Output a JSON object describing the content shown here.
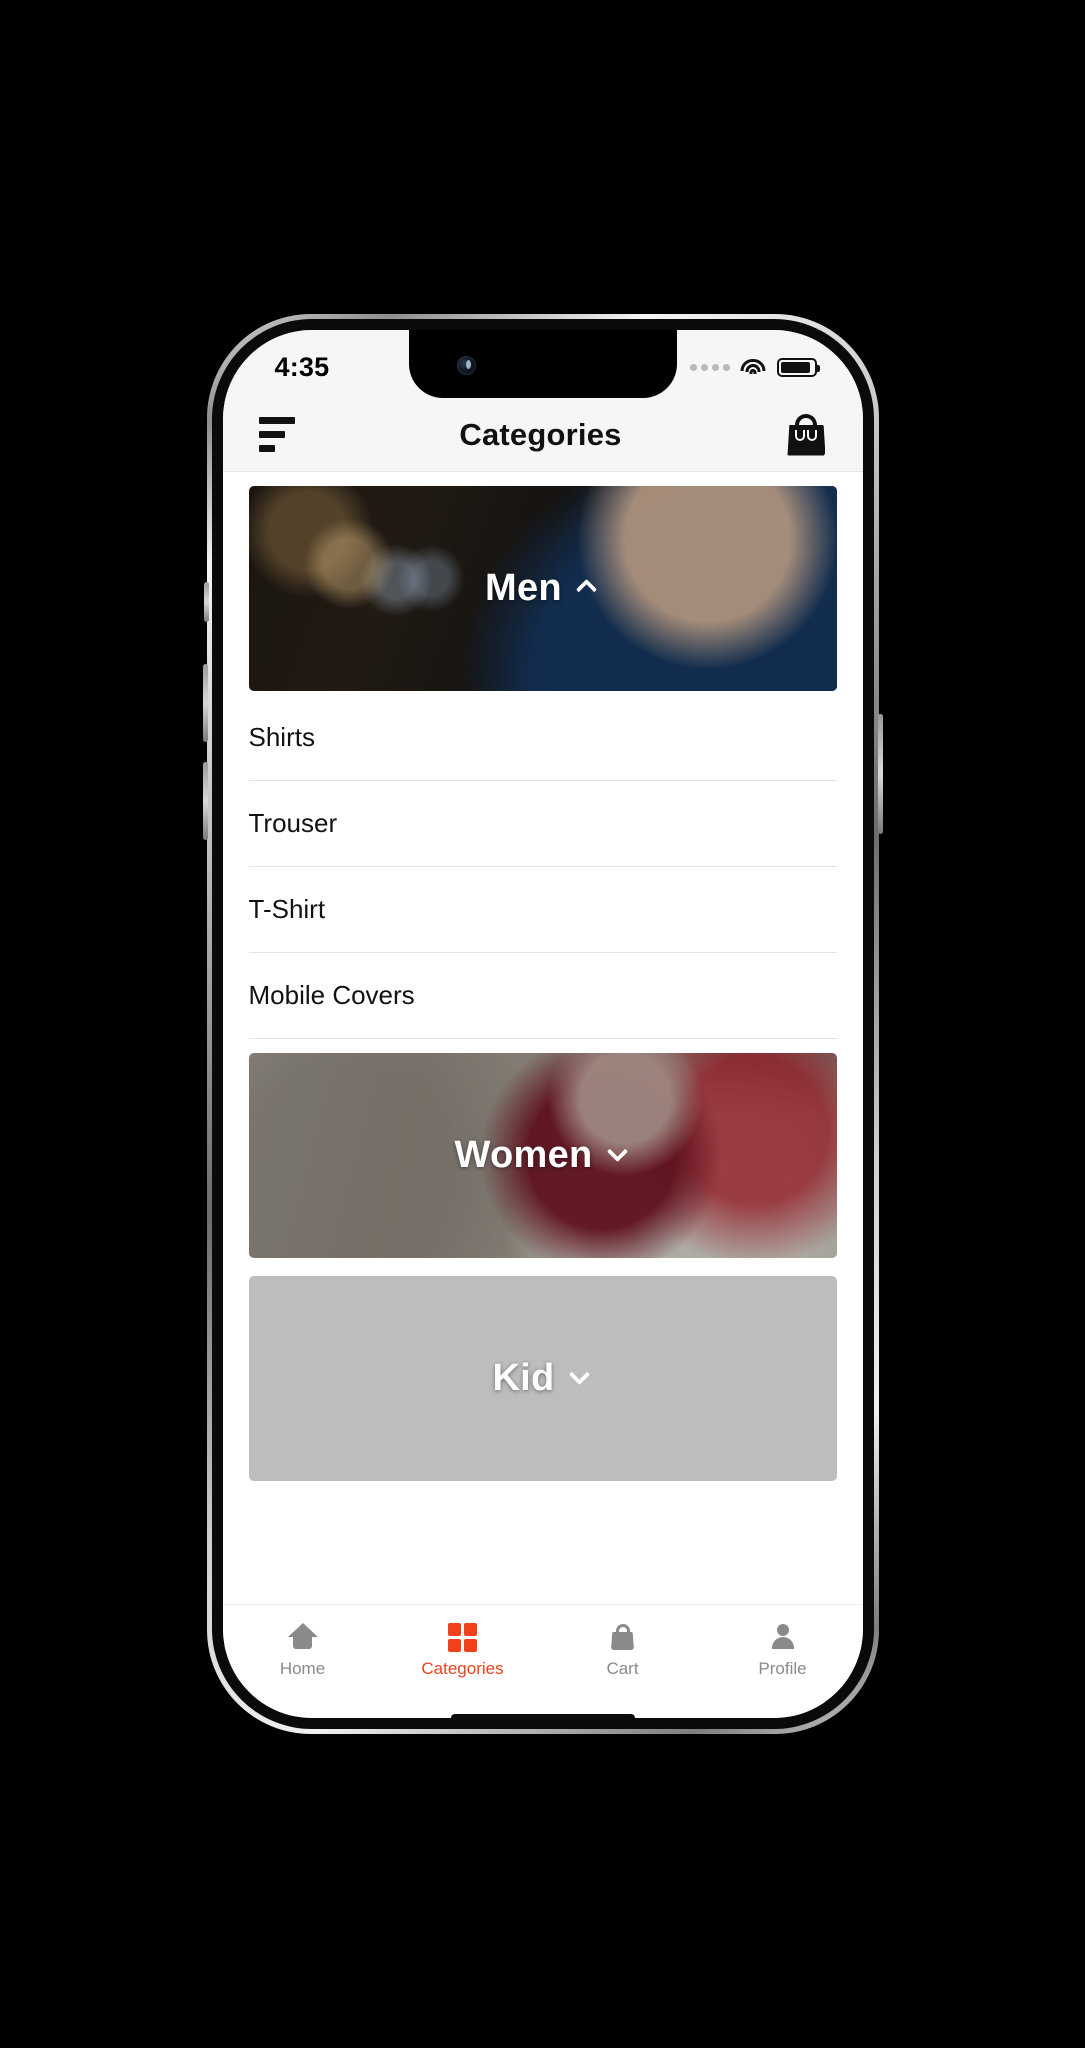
{
  "status_bar": {
    "time": "4:35",
    "signal_icon": "signal-dots-icon",
    "wifi_icon": "wifi-icon",
    "battery_icon": "battery-icon"
  },
  "header": {
    "menu_icon": "hamburger-menu-icon",
    "title": "Categories",
    "cart_icon": "shopping-bag-icon"
  },
  "categories": [
    {
      "name": "Men",
      "expanded": true,
      "chevron": "chevron-up-icon",
      "subitems": [
        "Shirts",
        "Trouser",
        "T-Shirt",
        "Mobile Covers"
      ]
    },
    {
      "name": "Women",
      "expanded": false,
      "chevron": "chevron-down-icon",
      "subitems": []
    },
    {
      "name": "Kid",
      "expanded": false,
      "chevron": "chevron-down-icon",
      "subitems": []
    }
  ],
  "tabbar": {
    "active_color": "#f1421b",
    "inactive_color": "#8a8a8a",
    "items": [
      {
        "label": "Home",
        "icon": "home-icon",
        "active": false
      },
      {
        "label": "Categories",
        "icon": "grid-icon",
        "active": true
      },
      {
        "label": "Cart",
        "icon": "shopping-bag-icon",
        "active": false
      },
      {
        "label": "Profile",
        "icon": "user-icon",
        "active": false
      }
    ]
  }
}
